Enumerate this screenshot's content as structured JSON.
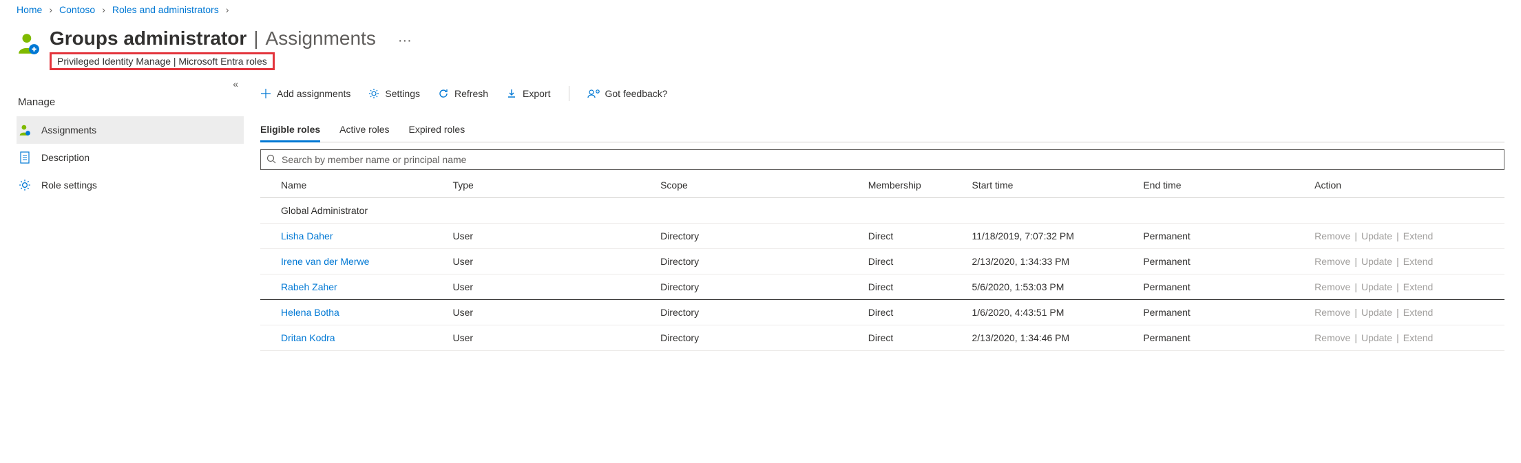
{
  "breadcrumb": [
    {
      "label": "Home"
    },
    {
      "label": "Contoso"
    },
    {
      "label": "Roles and administrators"
    }
  ],
  "header": {
    "title_bold": "Groups administrator",
    "title_sep": "|",
    "title_thin": "Assignments",
    "subtitle": "Privileged Identity Manage | Microsoft Entra roles",
    "ellipsis": "···"
  },
  "sidebar": {
    "section": "Manage",
    "items": [
      {
        "icon": "user",
        "label": "Assignments",
        "selected": true
      },
      {
        "icon": "doc",
        "label": "Description",
        "selected": false
      },
      {
        "icon": "gear",
        "label": "Role settings",
        "selected": false
      }
    ]
  },
  "toolbar": {
    "add": "Add assignments",
    "settings": "Settings",
    "refresh": "Refresh",
    "export": "Export",
    "feedback": "Got feedback?"
  },
  "tabs": [
    {
      "label": "Eligible roles",
      "active": true
    },
    {
      "label": "Active roles",
      "active": false
    },
    {
      "label": "Expired roles",
      "active": false
    }
  ],
  "search": {
    "placeholder": "Search by member name or principal name"
  },
  "columns": [
    "Name",
    "Type",
    "Scope",
    "Membership",
    "Start time",
    "End time",
    "Action"
  ],
  "group": "Global Administrator",
  "actions": {
    "remove": "Remove",
    "update": "Update",
    "extend": "Extend"
  },
  "rows": [
    {
      "name": "Lisha Daher",
      "type": "User",
      "scope": "Directory",
      "membership": "Direct",
      "start": "11/18/2019, 7:07:32 PM",
      "end": "Permanent",
      "focused": false
    },
    {
      "name": "Irene van der Merwe",
      "type": "User",
      "scope": "Directory",
      "membership": "Direct",
      "start": "2/13/2020, 1:34:33 PM",
      "end": "Permanent",
      "focused": false
    },
    {
      "name": "Rabeh Zaher",
      "type": "User",
      "scope": "Directory",
      "membership": "Direct",
      "start": "5/6/2020, 1:53:03 PM",
      "end": "Permanent",
      "focused": true
    },
    {
      "name": "Helena Botha",
      "type": "User",
      "scope": "Directory",
      "membership": "Direct",
      "start": "1/6/2020, 4:43:51 PM",
      "end": "Permanent",
      "focused": false
    },
    {
      "name": "Dritan Kodra",
      "type": "User",
      "scope": "Directory",
      "membership": "Direct",
      "start": "2/13/2020, 1:34:46 PM",
      "end": "Permanent",
      "focused": false
    }
  ]
}
